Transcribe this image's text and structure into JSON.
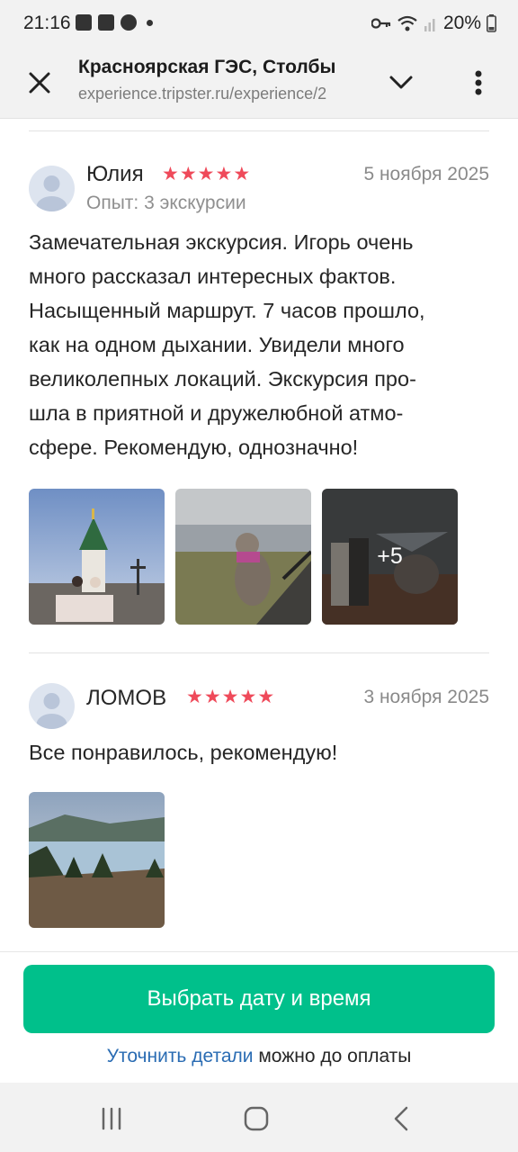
{
  "status_bar": {
    "time": "21:16",
    "battery": "20%"
  },
  "browser": {
    "title": "Красноярская ГЭС, Столбы",
    "url": "experience.tripster.ru/experience/2"
  },
  "reviews": [
    {
      "author": "Юлия",
      "rating": 5,
      "date": "5 ноября 2025",
      "experience": "Опыт: 3 экскурсии",
      "text_lines": [
        "Замечательная экскурсия. Игорь очень",
        "много рассказал интересных фактов.",
        "Насыщенный маршрут. 7 часов прошло,",
        "как на одном дыхании. Увидели много",
        "великолепных локаций. Экскурсия про-",
        "шла в приятной и дружелюбной атмо-",
        "сфере. Рекомендую, однозначно!"
      ],
      "more_photos": "+5"
    },
    {
      "author": "ЛОМОВ",
      "rating": 5,
      "date": "3 ноября 2025",
      "text": "Все понравилось, рекомендую!"
    }
  ],
  "cta": {
    "button_label": "Выбрать дату и время",
    "details_link": "Уточнить детали",
    "details_suffix": " можно до оплаты"
  },
  "colors": {
    "accent": "#00c08b",
    "star": "#ef4a5a",
    "link": "#2a6cb3"
  }
}
